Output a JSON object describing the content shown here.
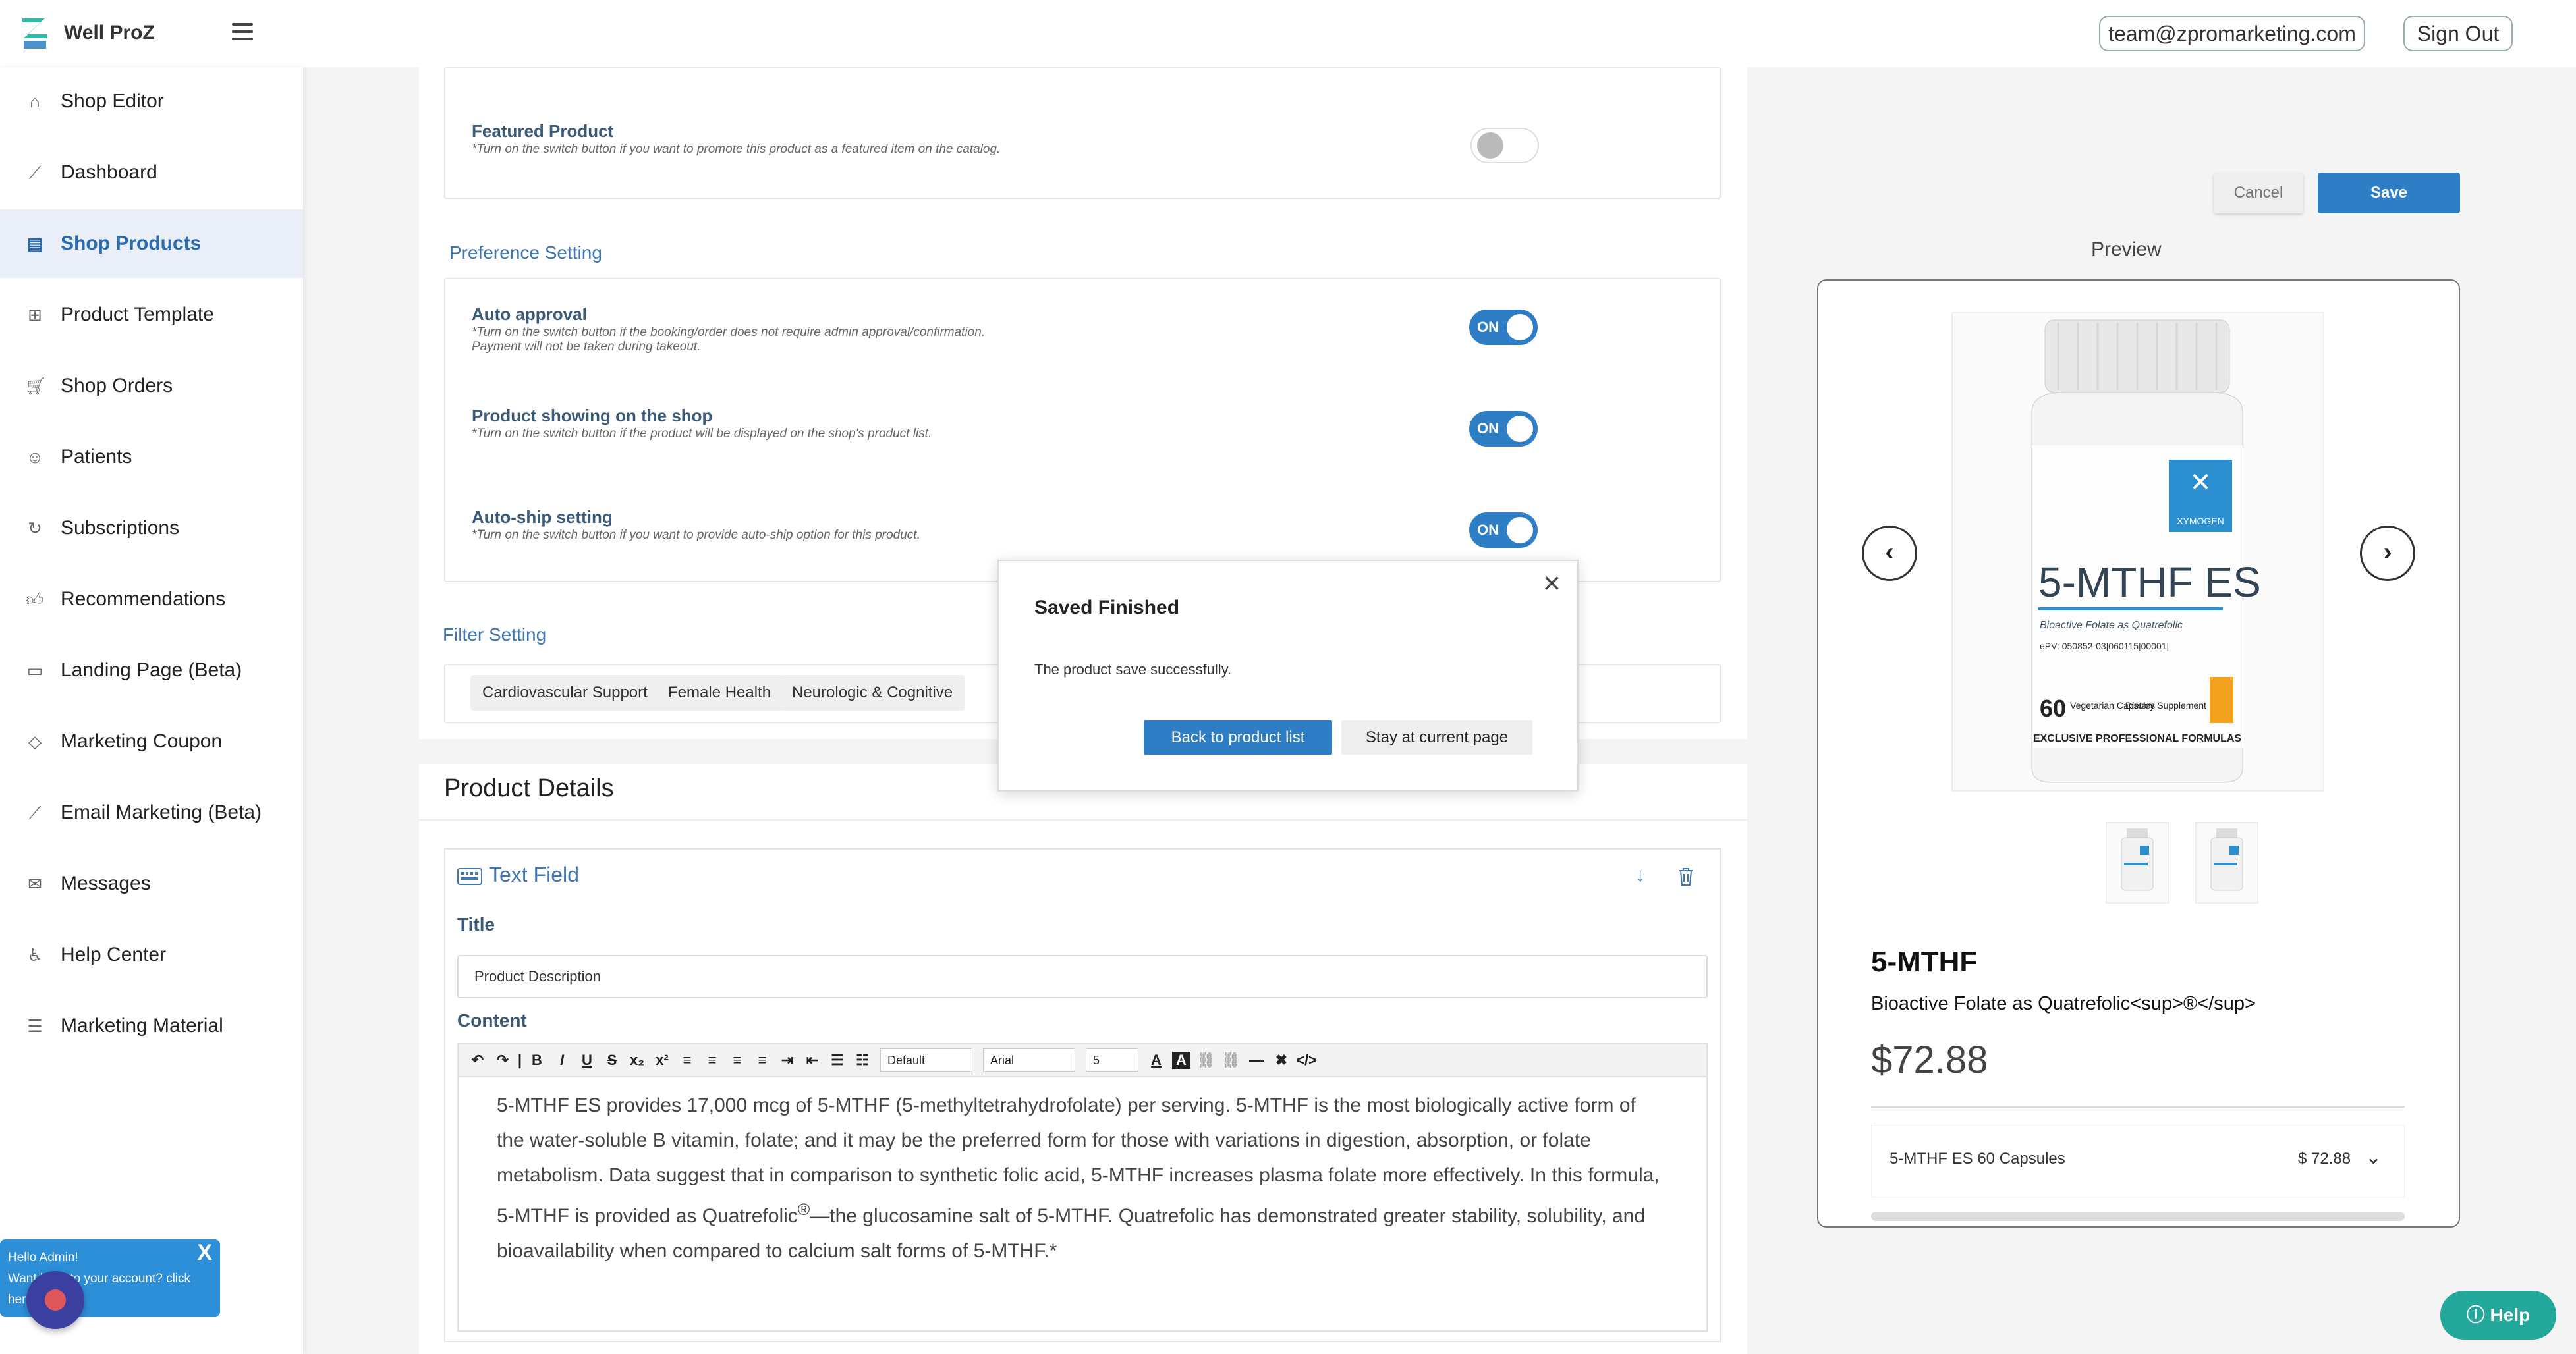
{
  "header": {
    "brand": "Well ProZ",
    "email": "team@zpromarketing.com",
    "signout": "Sign Out"
  },
  "sidebar": {
    "items": [
      {
        "label": "Shop Editor",
        "icon": "store-icon"
      },
      {
        "label": "Dashboard",
        "icon": "chart-line-icon"
      },
      {
        "label": "Shop Products",
        "icon": "clipboard-icon",
        "active": true
      },
      {
        "label": "Product Template",
        "icon": "file-plus-icon"
      },
      {
        "label": "Shop Orders",
        "icon": "cart-icon"
      },
      {
        "label": "Patients",
        "icon": "users-icon"
      },
      {
        "label": "Subscriptions",
        "icon": "refresh-icon"
      },
      {
        "label": "Recommendations",
        "icon": "thumbs-up-icon"
      },
      {
        "label": "Landing Page (Beta)",
        "icon": "id-card-icon"
      },
      {
        "label": "Marketing Coupon",
        "icon": "tag-icon"
      },
      {
        "label": "Email Marketing (Beta)",
        "icon": "chart-line-icon"
      },
      {
        "label": "Messages",
        "icon": "mail-icon"
      },
      {
        "label": "Help Center",
        "icon": "accessibility-icon"
      },
      {
        "label": "Marketing Material",
        "icon": "list-icon"
      }
    ]
  },
  "hello": {
    "title": "Hello Admin!",
    "line2": "Want back to your account? click",
    "line3": "here",
    "close": "X"
  },
  "settings": {
    "featured": {
      "title": "Featured Product",
      "desc": "*Turn on the switch button if you want to promote this product as a featured item on the catalog."
    },
    "preference_heading": "Preference Setting",
    "auto_approval": {
      "title": "Auto approval",
      "desc1": "*Turn on the switch button if the booking/order does not require admin approval/confirmation.",
      "desc2": "Payment will not be taken during takeout.",
      "toggle": "ON"
    },
    "showing": {
      "title": "Product showing on the shop",
      "desc": "*Turn on the switch button if the product will be displayed on the shop's product list.",
      "toggle": "ON"
    },
    "autoship": {
      "title": "Auto-ship setting",
      "desc": "*Turn on the switch button if you want to provide auto-ship option for this product.",
      "toggle": "ON"
    },
    "filter_heading": "Filter Setting",
    "tags": [
      "Cardiovascular Support",
      "Female Health",
      "Neurologic & Cognitive"
    ]
  },
  "details": {
    "heading": "Product Details",
    "field_label": "Text Field",
    "title_label": "Title",
    "title_value": "Product Description",
    "content_label": "Content",
    "toolbar": {
      "format": "Default",
      "font": "Arial",
      "size": "5"
    },
    "content_p1": "5-MTHF ES provides 17,000 mcg of 5-MTHF (5-methyltetrahydrofolate) per serving. 5-MTHF is the most biologically active form of the water-soluble B vitamin, folate;  and it may be the preferred form for those with variations in digestion, absorption, or folate metabolism. Data suggest that in comparison to synthetic folic acid, 5-MTHF increases plasma folate more effectively. In this formula, 5-MTHF is provided as Quatrefolic",
    "content_sup": "®",
    "content_p2": "—the glucosamine salt of 5-MTHF. Quatrefolic has demonstrated greater stability, solubility, and bioavailability when compared to calcium salt forms of 5-MTHF.*"
  },
  "actions": {
    "cancel": "Cancel",
    "save": "Save"
  },
  "preview": {
    "heading": "Preview",
    "name": "5-MTHF",
    "subtitle": "Bioactive Folate as Quatrefolic<sup>®</sup>",
    "price": "$72.88",
    "variant_name": "5-MTHF ES 60 Capsules",
    "variant_price": "$ 72.88",
    "bottle": {
      "brand": "XYMOGEN",
      "product": "5-MTHF ES",
      "sub": "Bioactive Folate as Quatrefolic",
      "epv": "ePV: 050852-03|060115|00001|",
      "count": "60",
      "count_label": "Vegetarian Capsules",
      "supp": "Dietary Supplement",
      "footer": "EXCLUSIVE PROFESSIONAL FORMULAS"
    }
  },
  "modal": {
    "title": "Saved Finished",
    "text": "The product save successfully.",
    "back": "Back to product list",
    "stay": "Stay at current page",
    "close": "×"
  },
  "help": {
    "label": "Help"
  }
}
